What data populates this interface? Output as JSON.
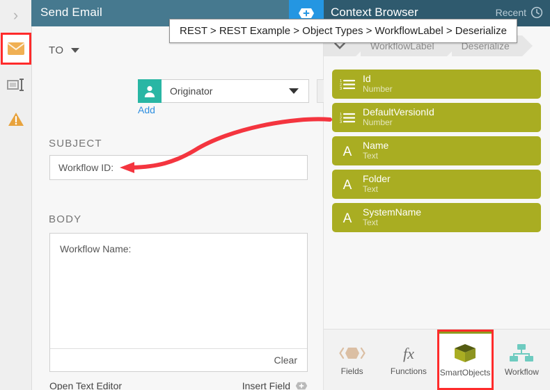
{
  "header": {
    "left_title": "Send Email",
    "right_title": "Context Browser",
    "recent_label": "Recent",
    "add_icon": "hexagon-plus-icon",
    "clock_icon": "clock-icon"
  },
  "tooltip": {
    "text": "REST > REST Example > Object Types > WorkflowLabel > Deserialize"
  },
  "sidebar": {
    "expand_icon": "chevron-right-icon",
    "items": [
      {
        "name": "email-envelope-icon",
        "selected": true
      },
      {
        "name": "text-field-icon",
        "selected": false
      },
      {
        "name": "warning-triangle-icon",
        "selected": false
      }
    ]
  },
  "form": {
    "to_label": "TO",
    "recipient_value": "Originator",
    "recipient_avatar_icon": "user-icon",
    "recipient_caret_icon": "chevron-down-icon",
    "add_label": "Add",
    "edit_icon": "pencil-icon",
    "subject_label": "SUBJECT",
    "subject_value": "Workflow ID:",
    "body_label": "BODY",
    "body_value": "Workflow Name:",
    "clear_label": "Clear",
    "open_text_editor_label": "Open Text Editor",
    "insert_field_label": "Insert Field",
    "insert_field_icon": "hexagon-plus-icon"
  },
  "context": {
    "breadcrumb": [
      {
        "label": "",
        "icon": "chevron-down-icon"
      },
      {
        "label": "WorkflowLabel",
        "icon": ""
      },
      {
        "label": "Deserialize",
        "icon": ""
      }
    ],
    "items": [
      {
        "name": "Id",
        "type": "Number",
        "icon": "number-list-icon"
      },
      {
        "name": "DefaultVersionId",
        "type": "Number",
        "icon": "number-list-icon"
      },
      {
        "name": "Name",
        "type": "Text",
        "icon": "text-a-icon"
      },
      {
        "name": "Folder",
        "type": "Text",
        "icon": "text-a-icon"
      },
      {
        "name": "SystemName",
        "type": "Text",
        "icon": "text-a-icon"
      }
    ],
    "tabs": [
      {
        "label": "Fields",
        "icon": "hexagon-brackets-icon",
        "selected": false
      },
      {
        "label": "Functions",
        "icon": "fx-icon",
        "selected": false
      },
      {
        "label": "SmartObjects",
        "icon": "cube-icon",
        "selected": true
      },
      {
        "label": "Workflow",
        "icon": "org-chart-icon",
        "selected": false
      }
    ]
  },
  "colors": {
    "header_left": "#46798f",
    "header_right": "#2f5a6e",
    "add_button": "#2496e2",
    "item_olive": "#a9ad22",
    "avatar_teal": "#29b6a4",
    "annotation_red": "#ff2b2b",
    "link_blue": "#2f8fe0"
  }
}
